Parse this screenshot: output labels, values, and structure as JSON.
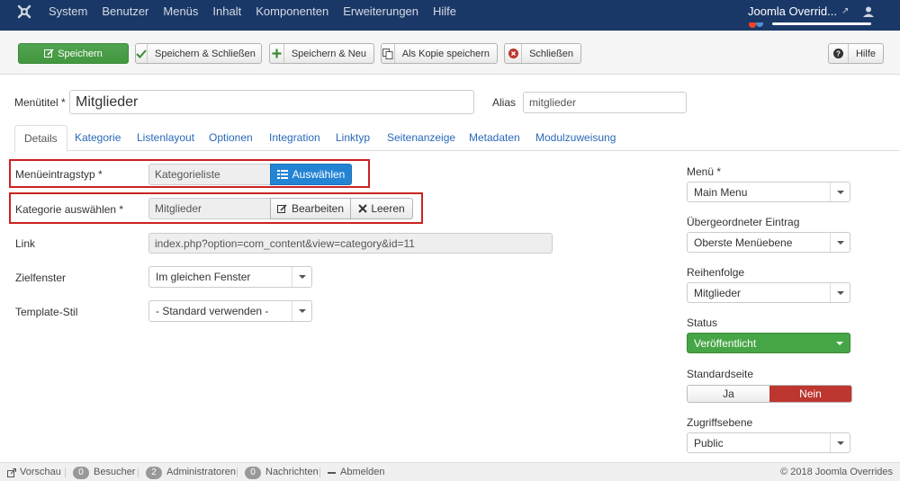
{
  "navbar": {
    "menu": [
      "System",
      "Benutzer",
      "Menüs",
      "Inhalt",
      "Komponenten",
      "Erweiterungen",
      "Hilfe"
    ],
    "site_link": "Joomla Overrid..."
  },
  "toolbar": {
    "save": "Speichern",
    "save_close": "Speichern & Schließen",
    "save_new": "Speichern & Neu",
    "save_copy": "Als Kopie speichern",
    "close": "Schließen",
    "help": "Hilfe"
  },
  "form": {
    "title_label": "Menütitel *",
    "title_value": "Mitglieder",
    "alias_label": "Alias",
    "alias_value": "mitglieder"
  },
  "tabs": [
    "Details",
    "Kategorie",
    "Listenlayout",
    "Optionen",
    "Integration",
    "Linktyp",
    "Seitenanzeige",
    "Metadaten",
    "Modulzuweisung"
  ],
  "details": {
    "type_label": "Menüeintragstyp *",
    "type_value": "Kategorieliste",
    "type_button": "Auswählen",
    "category_label": "Kategorie auswählen *",
    "category_value": "Mitglieder",
    "edit_button": "Bearbeiten",
    "clear_button": "Leeren",
    "link_label": "Link",
    "link_value": "index.php?option=com_content&view=category&id=11",
    "target_label": "Zielfenster",
    "target_value": "Im gleichen Fenster",
    "template_label": "Template-Stil",
    "template_value": "- Standard verwenden -"
  },
  "sidebar": {
    "menu_label": "Menü *",
    "menu_value": "Main Menu",
    "parent_label": "Übergeordneter Eintrag",
    "parent_value": "Oberste Menüebene",
    "order_label": "Reihenfolge",
    "order_value": "Mitglieder",
    "status_label": "Status",
    "status_value": "Veröffentlicht",
    "default_label": "Standardseite",
    "default_yes": "Ja",
    "default_no": "Nein",
    "access_label": "Zugriffsebene",
    "access_value": "Public"
  },
  "footer": {
    "preview": "Vorschau",
    "visitors_count": "0",
    "visitors": "Besucher",
    "admins_count": "2",
    "admins": "Administratoren",
    "messages_count": "0",
    "messages": "Nachrichten",
    "logout": "Abmelden",
    "copyright": "© 2018 Joomla Overrides"
  },
  "colors": {
    "navbar": "#1a3867",
    "save_green": "#46a546",
    "primary_blue": "#2384d3",
    "highlight_red": "#cc2222",
    "toggle_red": "#bd362f"
  }
}
